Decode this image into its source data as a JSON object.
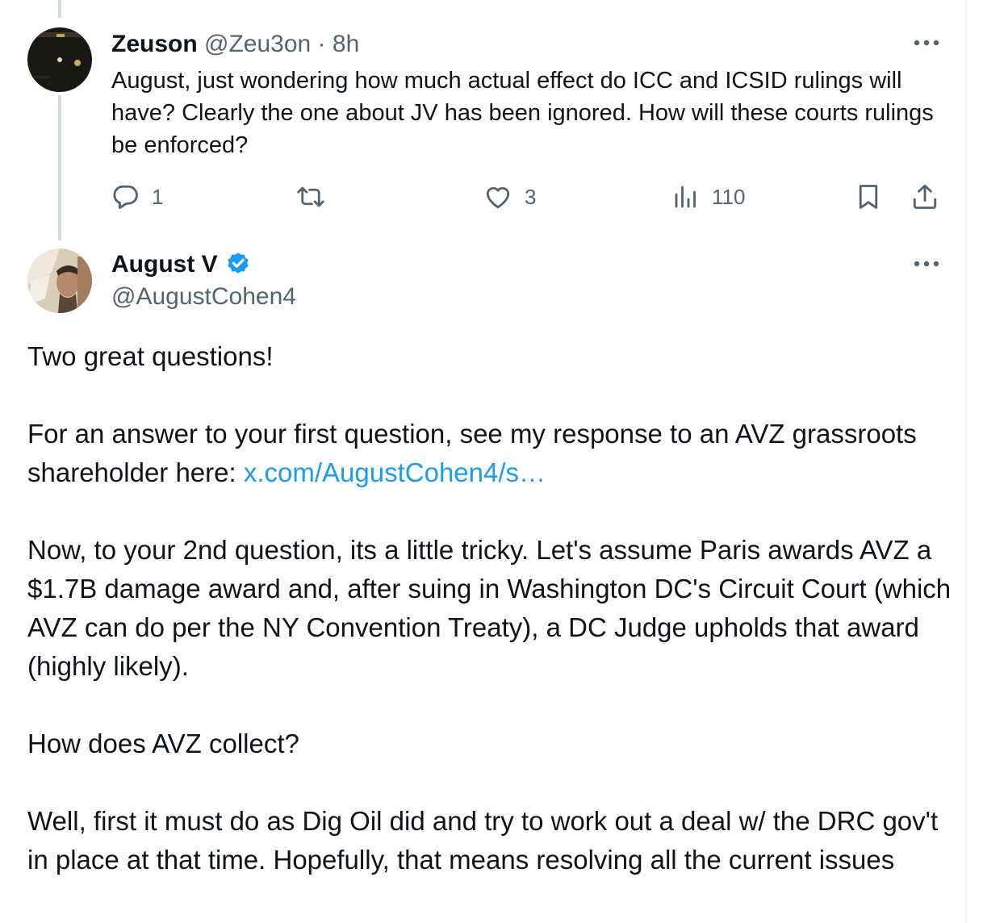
{
  "reply_tweet": {
    "author_name": "Zeuson",
    "author_handle": "@Zeu3on",
    "separator": " · ",
    "time": "8h",
    "text": "August, just wondering how much actual effect do ICC and ICSID rulings will have? Clearly the one about JV has been ignored. How will these courts rulings be enforced?",
    "actions": {
      "reply_count": "1",
      "retweet_count": "",
      "like_count": "3",
      "views_count": "110"
    }
  },
  "main_tweet": {
    "author_name": "August V",
    "author_handle": "@AugustCohen4",
    "verified": true,
    "paragraphs": {
      "p1": "Two great questions!",
      "p2_before_link": "For an answer to your first question, see my response to an AVZ grassroots shareholder here: ",
      "p2_link": "x.com/AugustCohen4/s…",
      "p3": "Now, to your 2nd question, its a little tricky. Let's assume Paris awards AVZ a $1.7B damage award and, after suing in Washington DC's Circuit Court (which AVZ can do per the NY Convention Treaty), a DC Judge upholds that award (highly likely).",
      "p4": "How does AVZ collect?",
      "p5": "Well, first it must do as Dig Oil did and try to work out a deal w/ the DRC gov't in place at that time. Hopefully, that means resolving all the current issues"
    }
  },
  "icons": {
    "reply": "speech-bubble-icon",
    "retweet": "retweet-arrows-icon",
    "like": "heart-icon",
    "views": "bar-chart-icon",
    "bookmark": "bookmark-icon",
    "share": "share-upload-icon",
    "more": "ellipsis-icon",
    "verified": "verified-badge-icon"
  },
  "colors": {
    "text": "#0f1419",
    "muted": "#536471",
    "link": "#1d9bf0",
    "verified": "#1d9bf0",
    "thread_line": "#cfd9de"
  }
}
